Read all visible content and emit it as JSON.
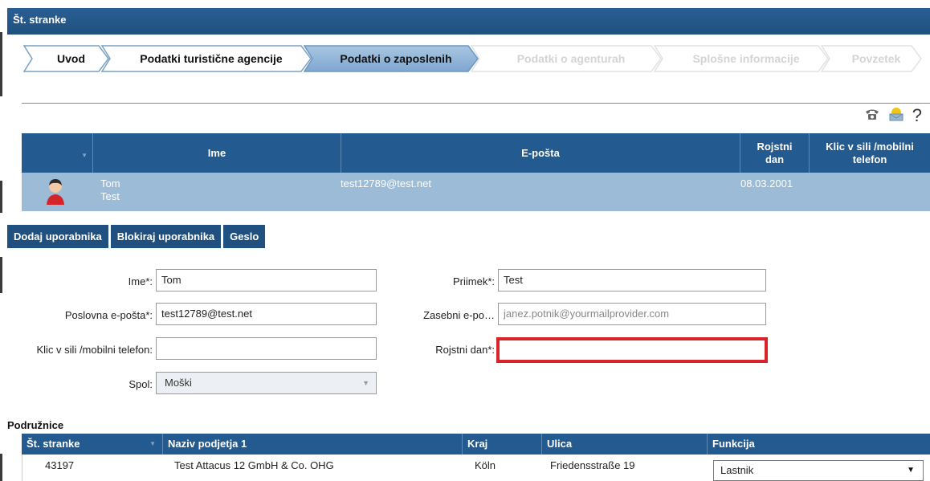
{
  "window": {
    "title": "Št. stranke"
  },
  "wizard": {
    "steps": [
      {
        "label": "Uvod",
        "state": "done"
      },
      {
        "label": "Podatki turistične agencije",
        "state": "done"
      },
      {
        "label": "Podatki o zaposlenih",
        "state": "active"
      },
      {
        "label": "Podatki o agenturah",
        "state": "disabled"
      },
      {
        "label": "Splošne informacije",
        "state": "disabled"
      },
      {
        "label": "Povzetek",
        "state": "disabled"
      }
    ]
  },
  "toolbar": {
    "phone_icon": "phone-icon",
    "mail_icon": "mail-icon",
    "help_label": "?"
  },
  "employees_grid": {
    "columns": [
      "",
      "Ime",
      "E-pošta",
      "Rojstni dan",
      "Klic v sili /mobilni telefon"
    ],
    "rows": [
      {
        "first_name": "Tom",
        "last_name": "Test",
        "email": "test12789@test.net",
        "birthday": "08.03.2001",
        "phone": ""
      }
    ]
  },
  "actions": {
    "add_user": "Dodaj uporabnika",
    "block_user": "Blokiraj uporabnika",
    "password": "Geslo"
  },
  "form": {
    "first_name_label": "Ime*:",
    "first_name_value": "Tom",
    "last_name_label": "Priimek*:",
    "last_name_value": "Test",
    "business_email_label": "Poslovna e-pošta*:",
    "business_email_value": "test12789@test.net",
    "private_email_label": "Zasebni e-po…",
    "private_email_placeholder": "janez.potnik@yourmailprovider.com",
    "phone_label": "Klic v sili /mobilni telefon:",
    "phone_value": "",
    "birthday_label": "Rojstni dan*:",
    "birthday_value": "",
    "gender_label": "Spol:",
    "gender_value": "Moški"
  },
  "branches": {
    "title": "Podružnice",
    "columns": [
      "Št. stranke",
      "Naziv podjetja 1",
      "Kraj",
      "Ulica",
      "Funkcija"
    ],
    "rows": [
      {
        "customer_no": "43197",
        "company": "Test Attacus 12 GmbH & Co. OHG",
        "city": "Köln",
        "street": "Friedensstraße 19",
        "role": "Lastnik"
      }
    ]
  },
  "colors": {
    "header_blue": "#235a8f",
    "row_selected": "#9bbbd6",
    "error_red": "#d9232a"
  }
}
